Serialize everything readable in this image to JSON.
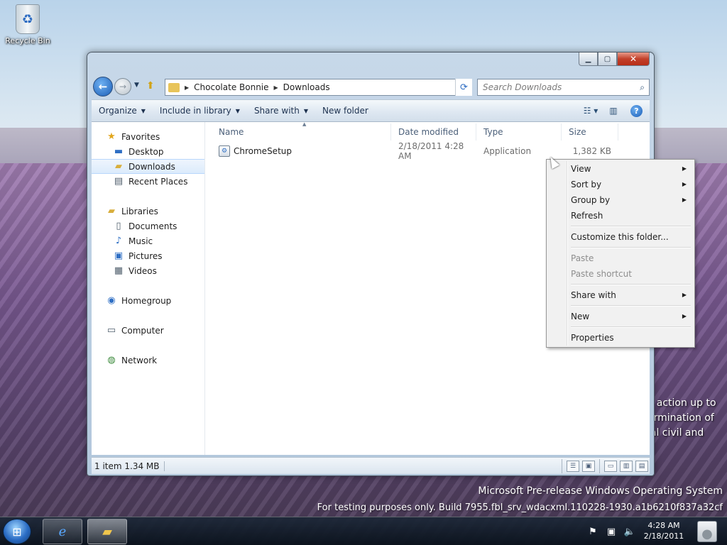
{
  "desktop": {
    "recycle_bin_label": "Recycle Bin",
    "watermark_line1": "Microsoft Pre-release Windows Operating System",
    "watermark_line2": "For testing purposes only. Build 7955.fbl_srv_wdacxml.110228-1930.a1b6210f837a32cf",
    "background_text_lines": [
      "y action up to",
      "ermination of",
      "ial civil and"
    ]
  },
  "window": {
    "address": {
      "crumbs": [
        "Chocolate Bonnie",
        "Downloads"
      ]
    },
    "search": {
      "placeholder": "Search Downloads"
    },
    "toolbar": {
      "organize": "Organize",
      "include_in_library": "Include in library",
      "share_with": "Share with",
      "new_folder": "New folder"
    },
    "nav_pane": {
      "favorites": "Favorites",
      "desktop": "Desktop",
      "downloads": "Downloads",
      "recent_places": "Recent Places",
      "libraries": "Libraries",
      "documents": "Documents",
      "music": "Music",
      "pictures": "Pictures",
      "videos": "Videos",
      "homegroup": "Homegroup",
      "computer": "Computer",
      "network": "Network"
    },
    "columns": {
      "name": "Name",
      "date_modified": "Date modified",
      "type": "Type",
      "size": "Size"
    },
    "files": [
      {
        "name": "ChromeSetup",
        "date_modified": "2/18/2011 4:28 AM",
        "type": "Application",
        "size": "1,382 KB"
      }
    ],
    "status": {
      "text": "1 item 1.34 MB"
    }
  },
  "context_menu": {
    "view": "View",
    "sort_by": "Sort by",
    "group_by": "Group by",
    "refresh": "Refresh",
    "customize": "Customize this folder...",
    "paste": "Paste",
    "paste_shortcut": "Paste shortcut",
    "share_with": "Share with",
    "new": "New",
    "properties": "Properties"
  },
  "taskbar": {
    "clock_time": "4:28 AM",
    "clock_date": "2/18/2011"
  },
  "colors": {
    "window_chrome": "#b9cde1",
    "selection": "#dcebfc",
    "taskbar": "#1c2838"
  }
}
